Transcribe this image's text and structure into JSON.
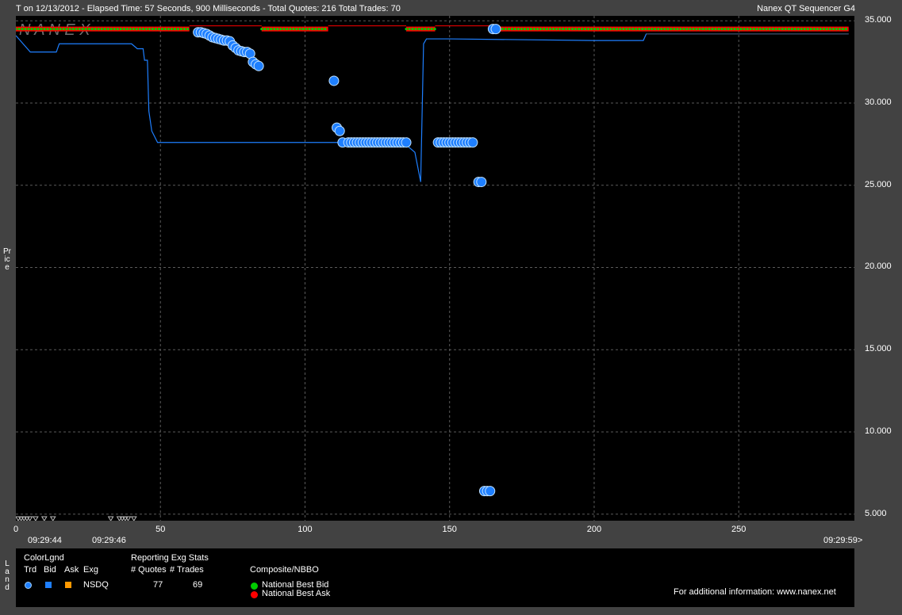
{
  "header": {
    "title": "T on 12/13/2012  -  Elapsed Time: 57 Seconds, 900 Milliseconds  -  Total Quotes: 216  Total Trades: 70",
    "app_name": "Nanex QT Sequencer G4",
    "watermark": "N A N E X"
  },
  "chart_data": {
    "type": "scatter",
    "ylabel": "Price",
    "xlim": [
      0,
      290
    ],
    "ylim": [
      4.6,
      35.3
    ],
    "grid": true,
    "x_ticks": [
      "0",
      "50",
      "100",
      "150",
      "200",
      "250"
    ],
    "y_ticks": [
      "35.000",
      "30.000",
      "25.000",
      "20.000",
      "15.000",
      "10.000",
      "5.000"
    ],
    "time_labels": [
      "09:29:44",
      "09:29:46",
      "09:29:59>"
    ],
    "series": [
      {
        "name": "National Best Ask",
        "color": "#ff0000",
        "values": [
          [
            0,
            34.5
          ],
          [
            12,
            34.5
          ],
          [
            24,
            34.5
          ],
          [
            36,
            34.5
          ],
          [
            48,
            34.5
          ],
          [
            60,
            34.5
          ],
          [
            85,
            34.5
          ],
          [
            96,
            34.5
          ],
          [
            108,
            34.5
          ],
          [
            135,
            34.5
          ],
          [
            145,
            34.5
          ],
          [
            165,
            34.5
          ],
          [
            180,
            34.5
          ],
          [
            200,
            34.5
          ],
          [
            220,
            34.5
          ],
          [
            240,
            34.5
          ],
          [
            260,
            34.5
          ],
          [
            280,
            34.5
          ],
          [
            288,
            34.5
          ]
        ]
      },
      {
        "name": "National Best Bid",
        "color": "#00cc00",
        "values": [
          [
            0,
            34.4
          ],
          [
            20,
            34.4
          ],
          [
            40,
            34.4
          ],
          [
            60,
            34.4
          ],
          [
            85,
            34.4
          ],
          [
            108,
            34.4
          ],
          [
            135,
            34.4
          ],
          [
            145,
            34.4
          ],
          [
            165,
            34.4
          ],
          [
            200,
            34.4
          ],
          [
            240,
            34.4
          ],
          [
            288,
            34.4
          ]
        ]
      },
      {
        "name": "NSDQ Bid",
        "color": "#1e7fff",
        "values": [
          [
            0,
            34.1
          ],
          [
            5,
            33.1
          ],
          [
            14,
            33.1
          ],
          [
            15,
            33.6
          ],
          [
            40,
            33.6
          ],
          [
            42,
            33.3
          ],
          [
            44,
            33.3
          ],
          [
            44.5,
            32.6
          ],
          [
            45.5,
            32.6
          ],
          [
            46,
            29.5
          ],
          [
            47,
            28.3
          ],
          [
            49,
            27.6
          ],
          [
            100,
            27.6
          ],
          [
            134,
            27.6
          ],
          [
            138,
            27.0
          ],
          [
            140,
            25.2
          ],
          [
            141,
            33.6
          ],
          [
            142,
            33.9
          ],
          [
            150,
            33.9
          ],
          [
            200,
            33.8
          ],
          [
            217,
            33.8
          ],
          [
            218,
            34.2
          ],
          [
            288,
            34.2
          ]
        ]
      },
      {
        "name": "NSDQ Trd",
        "color": "#1e7fff",
        "values": [
          [
            63,
            34.3
          ],
          [
            64,
            34.3
          ],
          [
            65,
            34.25
          ],
          [
            66,
            34.2
          ],
          [
            67,
            34.1
          ],
          [
            68,
            34.0
          ],
          [
            69,
            33.95
          ],
          [
            70,
            33.9
          ],
          [
            71,
            33.85
          ],
          [
            72,
            33.8
          ],
          [
            73,
            33.8
          ],
          [
            74,
            33.75
          ],
          [
            75,
            33.5
          ],
          [
            76,
            33.35
          ],
          [
            77,
            33.2
          ],
          [
            78,
            33.15
          ],
          [
            79,
            33.1
          ],
          [
            80,
            33.1
          ],
          [
            81,
            33.0
          ],
          [
            82,
            32.5
          ],
          [
            83,
            32.35
          ],
          [
            84,
            32.25
          ],
          [
            110,
            31.35
          ],
          [
            111,
            28.5
          ],
          [
            112,
            28.3
          ],
          [
            113,
            27.6
          ],
          [
            115,
            27.6
          ],
          [
            116,
            27.6
          ],
          [
            117,
            27.6
          ],
          [
            118,
            27.6
          ],
          [
            119,
            27.6
          ],
          [
            120,
            27.6
          ],
          [
            121,
            27.6
          ],
          [
            122,
            27.6
          ],
          [
            123,
            27.6
          ],
          [
            124,
            27.6
          ],
          [
            125,
            27.6
          ],
          [
            126,
            27.6
          ],
          [
            127,
            27.6
          ],
          [
            128,
            27.6
          ],
          [
            129,
            27.6
          ],
          [
            130,
            27.6
          ],
          [
            131,
            27.6
          ],
          [
            132,
            27.6
          ],
          [
            133,
            27.6
          ],
          [
            134,
            27.6
          ],
          [
            135,
            27.6
          ],
          [
            146,
            27.6
          ],
          [
            147,
            27.6
          ],
          [
            148,
            27.6
          ],
          [
            149,
            27.6
          ],
          [
            150,
            27.6
          ],
          [
            151,
            27.6
          ],
          [
            152,
            27.6
          ],
          [
            153,
            27.6
          ],
          [
            154,
            27.6
          ],
          [
            155,
            27.6
          ],
          [
            156,
            27.6
          ],
          [
            157,
            27.6
          ],
          [
            158,
            27.6
          ],
          [
            160,
            25.2
          ],
          [
            161,
            25.2
          ],
          [
            162,
            6.4
          ],
          [
            163,
            6.4
          ],
          [
            164,
            6.4
          ],
          [
            165,
            34.5
          ],
          [
            166,
            34.5
          ]
        ]
      }
    ]
  },
  "legend": {
    "side_label": "Land",
    "color_legend_title": "ColorLgnd",
    "headers": {
      "trd": "Trd",
      "bid": "Bid",
      "ask": "Ask",
      "exg": "Exg"
    },
    "stats_title": "Reporting Exg Stats",
    "quotes_header": "# Quotes",
    "trades_header": "# Trades",
    "row": {
      "exchange": "NSDQ",
      "quotes": "77",
      "trades": "69"
    },
    "colors": {
      "trd": "#1e7fff",
      "bid": "#1e7fff",
      "ask": "#ff9900",
      "nbb": "#00cc00",
      "nba": "#ff0000"
    },
    "composite_title": "Composite/NBBO",
    "nbb_label": "National Best Bid",
    "nba_label": "National Best Ask",
    "info_text": "For additional information: www.nanex.net"
  }
}
